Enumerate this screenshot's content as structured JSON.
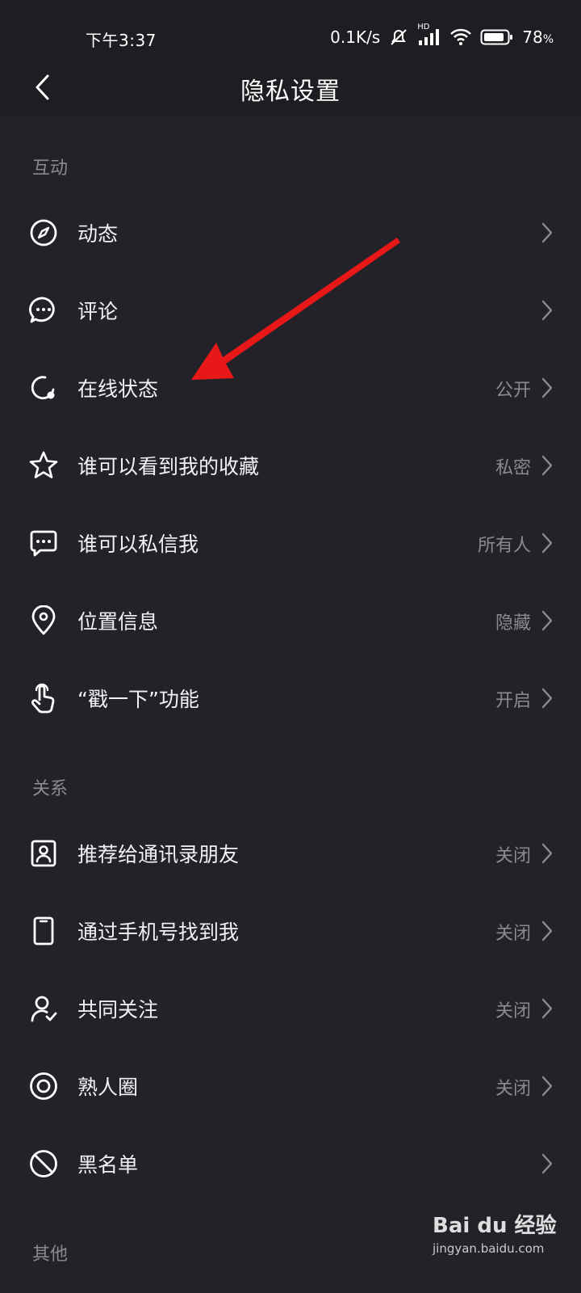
{
  "status_bar": {
    "time": "下午3:37",
    "network_speed": "0.1K/s",
    "network_type": "HD",
    "battery_percent": "78",
    "battery_percent_symbol": "%",
    "icons": [
      "mute-icon",
      "signal-icon",
      "wifi-icon",
      "battery-icon"
    ]
  },
  "header": {
    "title": "隐私设置",
    "back_icon": "back-chevron-icon"
  },
  "sections": {
    "interaction": {
      "header": "互动",
      "items": [
        {
          "label": "动态",
          "value": "",
          "icon": "compass-icon"
        },
        {
          "label": "评论",
          "value": "",
          "icon": "comment-bubble-icon"
        },
        {
          "label": "在线状态",
          "value": "公开",
          "icon": "online-status-icon"
        },
        {
          "label": "谁可以看到我的收藏",
          "value": "私密",
          "icon": "star-icon"
        },
        {
          "label": "谁可以私信我",
          "value": "所有人",
          "icon": "message-icon"
        },
        {
          "label": "位置信息",
          "value": "隐藏",
          "icon": "location-pin-icon"
        },
        {
          "label": "“戳一下”功能",
          "value": "开启",
          "icon": "poke-hand-icon"
        }
      ]
    },
    "relations": {
      "header": "关系",
      "items": [
        {
          "label": "推荐给通讯录朋友",
          "value": "关闭",
          "icon": "contacts-icon"
        },
        {
          "label": "通过手机号找到我",
          "value": "关闭",
          "icon": "phone-icon"
        },
        {
          "label": "共同关注",
          "value": "关闭",
          "icon": "mutual-follow-icon"
        },
        {
          "label": "熟人圈",
          "value": "关闭",
          "icon": "circle-icon"
        },
        {
          "label": "黑名单",
          "value": "",
          "icon": "block-icon"
        }
      ]
    },
    "other": {
      "header": "其他"
    }
  },
  "annotation": {
    "arrow_color": "#e81818"
  },
  "watermark": {
    "brand": "Bai du 经验",
    "url": "jingyan.baidu.com"
  },
  "colors": {
    "background": "#232228",
    "bar_background": "#1e1d22",
    "secondary_text": "#8b8a90"
  }
}
